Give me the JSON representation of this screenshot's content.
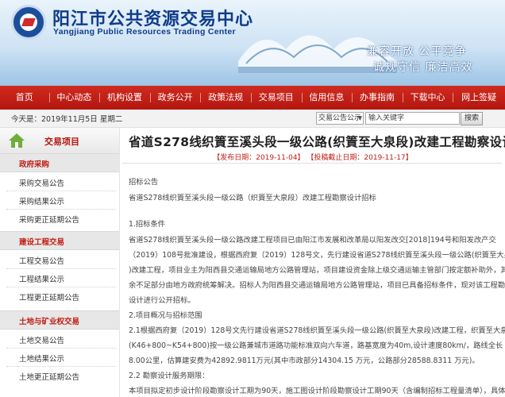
{
  "site": {
    "title": "阳江市公共资源交易中心",
    "subtitle": "Yangjiang Public Resources Trading Center",
    "slogan_line1": "兼容开放 公平竞争",
    "slogan_line2": "诚规守信 廉洁高效"
  },
  "nav": [
    "首页",
    "中心动态",
    "机构设置",
    "政务公开",
    "政策法规",
    "交易项目",
    "信用信息",
    "办事指南",
    "下载中心",
    "网上签疑"
  ],
  "infobar": {
    "date": "今天是：2019年11月5日 星期二",
    "select_value": "交易公告公示",
    "search_placeholder": "输入关键字",
    "search_button": "搜索"
  },
  "sidebar": {
    "title": "交易项目",
    "sections": [
      {
        "name": "政府采购",
        "items": [
          "采购交易公告",
          "采购结果公示",
          "采购更正延期公告"
        ]
      },
      {
        "name": "建设工程交易",
        "items": [
          "工程交易公告",
          "工程结果公示",
          "工程更正延期公告"
        ]
      },
      {
        "name": "土地与矿业权交易",
        "items": [
          "土地交易公告",
          "土地结果公示",
          "土地更正延期公告"
        ]
      }
    ]
  },
  "article": {
    "title": "省道S278线织篢至溪头段一级公路(织篢至大泉段)改建工程勘察设计",
    "meta": "【发布日期：2019-11-04】 【投稿截止日期：2019-11-17】",
    "lines": [
      "招标公告",
      "省道S278线织篢至溪头段一级公路（织篢至大泉段）改建工程勘察设计招标",
      "1.招标条件",
      "省道S278线织篢至溪头段一级公路改建工程项目已由阳江市发展和改革局以阳发改交[2018]194号和阳发改产交",
      "（2019）108号批准建设，根据西府复（2019）128号文，先行建设省道S278线织篢至溪头段一级公路(织篢至大泉段",
      ")改建工程，项目业主为阳西县交通运输局地方公路管理站，项目建设资金除上级交通运输主管部门按定额补助外，其",
      "余不足部分由地方政府统筹解决。招标人为阳西县交通运输局地方公路管理站，项目已具备招标条件，现对该工程勘察",
      "设计进行公开招标。",
      "2.项目概况与招标范围",
      "2.1根据西府复（2019）128号文先行建设省道S278线织篢至溪头段一级公路(织篢至大泉段)改建工程，织篢至大泉段",
      "(K46+800~K54+800)按一级公路兼城市道路功能标准双向六车道，路基宽度为40m,设计速度80km/，路线全长",
      "8.00公里，估算建安费为42892.9811万元(其中市政部分14304.15 万元，公路部分28588.8311 万元)。",
      "2.2 勘察设计服务期限：",
      "本项目拟定初步设计阶段勘察设计工期为90天，施工图设计阶段勘察设计工期90天（含编制招标工程量清单），具体如"
    ]
  }
}
